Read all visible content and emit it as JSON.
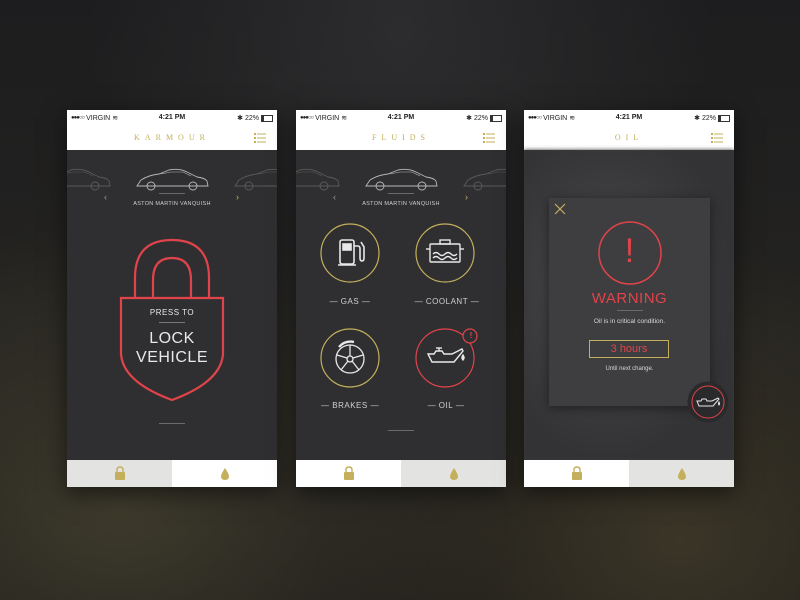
{
  "colors": {
    "gold": "#c4b05c",
    "red": "#e0444a",
    "dark": "#2f2f31",
    "line": "#9a9a9a"
  },
  "status": {
    "carrier": "VIRGIN",
    "time": "4:21 PM",
    "battery": "22%"
  },
  "screens": [
    {
      "title": "KARMOUR",
      "car_name": "ASTON MARTIN VANQUISH",
      "lock": {
        "line1": "PRESS TO",
        "line2": "LOCK",
        "line3": "VEHICLE"
      },
      "tabs": [
        "lock-icon",
        "drop-icon"
      ]
    },
    {
      "title": "FLUIDS",
      "car_name": "ASTON MARTIN VANQUISH",
      "fluids": [
        {
          "label": "GAS",
          "icon": "gas-pump-icon"
        },
        {
          "label": "COOLANT",
          "icon": "coolant-icon"
        },
        {
          "label": "BRAKES",
          "icon": "brakes-icon"
        },
        {
          "label": "OIL",
          "icon": "oil-can-icon",
          "alert": "!"
        }
      ],
      "tabs": [
        "lock-icon",
        "drop-icon"
      ]
    },
    {
      "title": "OIL",
      "warning": {
        "mark": "!",
        "heading": "WARNING",
        "message": "Oil is in critical condition.",
        "hours": "3 hours",
        "until": "Until next change."
      },
      "tabs": [
        "lock-icon",
        "drop-icon"
      ]
    }
  ]
}
